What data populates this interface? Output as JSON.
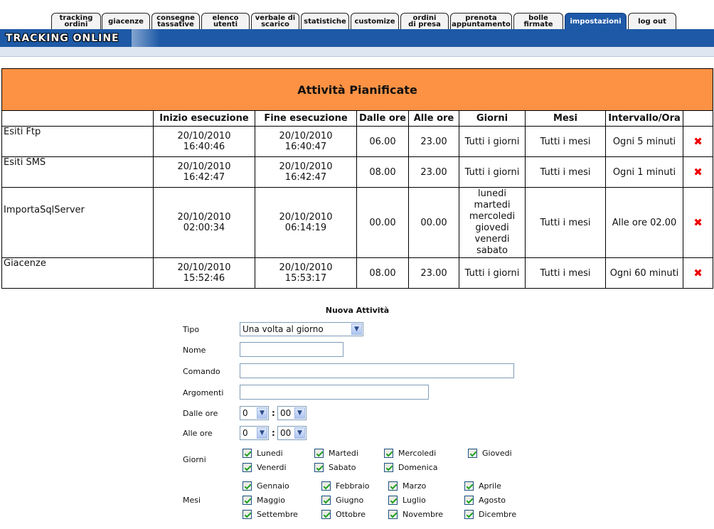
{
  "tabs": [
    {
      "label": "tracking\nordini"
    },
    {
      "label": "giacenze"
    },
    {
      "label": "consegne\ntassative"
    },
    {
      "label": "elenco\nutenti"
    },
    {
      "label": "verbale di\nscarico"
    },
    {
      "label": "statistiche"
    },
    {
      "label": "customize"
    },
    {
      "label": "ordini\ndi presa"
    },
    {
      "label": "prenota\nappuntamento"
    },
    {
      "label": "bolle\nfirmate"
    },
    {
      "label": "impostazioni"
    },
    {
      "label": "log out"
    }
  ],
  "active_tab": "impostazioni",
  "brand": "TRACKING ONLINE",
  "table": {
    "title": "Attività Pianificate",
    "headers": [
      "",
      "Inizio esecuzione",
      "Fine esecuzione",
      "Dalle ore",
      "Alle ore",
      "Giorni",
      "Mesi",
      "Intervallo/Ora",
      ""
    ],
    "rows": [
      {
        "name": "Esiti Ftp",
        "start_date": "20/10/2010",
        "start_time": "16:40:46",
        "end_date": "20/10/2010",
        "end_time": "16:40:47",
        "from": "06.00",
        "to": "23.00",
        "days": [
          "Tutti i giorni"
        ],
        "months": "Tutti i mesi",
        "interval": "Ogni 5 minuti",
        "delete": "✖"
      },
      {
        "name": "Esiti SMS",
        "start_date": "20/10/2010",
        "start_time": "16:42:47",
        "end_date": "20/10/2010",
        "end_time": "16:42:47",
        "from": "08.00",
        "to": "23.00",
        "days": [
          "Tutti i giorni"
        ],
        "months": "Tutti i mesi",
        "interval": "Ogni 1 minuti",
        "delete": "✖"
      },
      {
        "name": "ImportaSqlServer",
        "start_date": "20/10/2010",
        "start_time": "02:00:34",
        "end_date": "20/10/2010",
        "end_time": "06:14:19",
        "from": "00.00",
        "to": "00.00",
        "days": [
          "lunedi",
          "martedi",
          "mercoledi",
          "giovedi",
          "venerdi",
          "sabato"
        ],
        "months": "Tutti i mesi",
        "interval": "Alle ore 02.00",
        "delete": "✖"
      },
      {
        "name": "Giacenze",
        "start_date": "20/10/2010",
        "start_time": "15:52:46",
        "end_date": "20/10/2010",
        "end_time": "15:53:17",
        "from": "08.00",
        "to": "23.00",
        "days": [
          "Tutti i giorni"
        ],
        "months": "Tutti i mesi",
        "interval": "Ogni 60 minuti",
        "delete": "✖"
      }
    ]
  },
  "form": {
    "title": "Nuova Attività",
    "tipo_label": "Tipo",
    "tipo_value": "Una volta al giorno",
    "nome_label": "Nome",
    "nome_value": "",
    "comando_label": "Comando",
    "comando_value": "",
    "argomenti_label": "Argomenti",
    "argomenti_value": "",
    "dalle_label": "Dalle ore",
    "dalle_h": "0",
    "dalle_m": "00",
    "alle_label": "Alle ore",
    "alle_h": "0",
    "alle_m": "00",
    "colon": ":",
    "giorni_label": "Giorni",
    "giorni": [
      {
        "label": "Lunedi",
        "checked": true
      },
      {
        "label": "Martedi",
        "checked": true
      },
      {
        "label": "Mercoledi",
        "checked": true
      },
      {
        "label": "Giovedi",
        "checked": true
      },
      {
        "label": "Venerdi",
        "checked": true
      },
      {
        "label": "Sabato",
        "checked": true
      },
      {
        "label": "Domenica",
        "checked": true
      }
    ],
    "mesi_label": "Mesi",
    "mesi": [
      {
        "label": "Gennaio",
        "checked": true
      },
      {
        "label": "Febbraio",
        "checked": true
      },
      {
        "label": "Marzo",
        "checked": true
      },
      {
        "label": "Aprile",
        "checked": true
      },
      {
        "label": "Maggio",
        "checked": true
      },
      {
        "label": "Giugno",
        "checked": true
      },
      {
        "label": "Luglio",
        "checked": true
      },
      {
        "label": "Agosto",
        "checked": true
      },
      {
        "label": "Settembre",
        "checked": true
      },
      {
        "label": "Ottobre",
        "checked": true
      },
      {
        "label": "Novembre",
        "checked": true
      },
      {
        "label": "Dicembre",
        "checked": true
      }
    ]
  }
}
